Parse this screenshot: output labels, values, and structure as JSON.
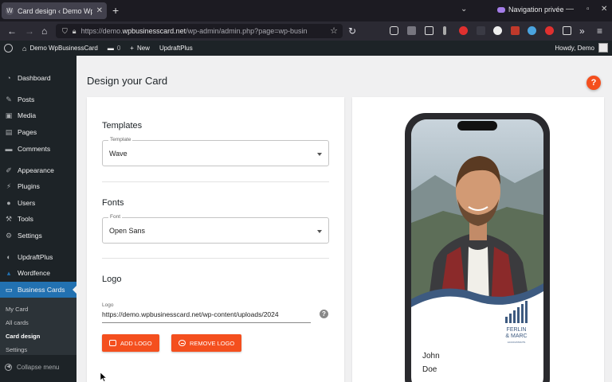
{
  "browser": {
    "tab_title": "Card design ‹ Demo WpB",
    "tab_close": "✕",
    "new_tab": "+",
    "private_label": "Navigation privée",
    "url_prefix": "https://demo.",
    "url_domain": "wpbusinesscard.net",
    "url_rest": "/wp-admin/admin.php?page=wp-busin"
  },
  "adminbar": {
    "site_name": "Demo WpBusinessCard",
    "comments_count": "0",
    "new_label": "New",
    "plugin_label": "UpdraftPlus",
    "howdy": "Howdy, Demo"
  },
  "sidebar": {
    "items": [
      {
        "label": "Dashboard",
        "icon": "dashboard-icon"
      },
      {
        "label": "Posts",
        "icon": "pin-icon"
      },
      {
        "label": "Media",
        "icon": "media-icon"
      },
      {
        "label": "Pages",
        "icon": "pages-icon"
      },
      {
        "label": "Comments",
        "icon": "comment-icon"
      },
      {
        "label": "Appearance",
        "icon": "brush-icon"
      },
      {
        "label": "Plugins",
        "icon": "plugin-icon"
      },
      {
        "label": "Users",
        "icon": "users-icon"
      },
      {
        "label": "Tools",
        "icon": "wrench-icon"
      },
      {
        "label": "Settings",
        "icon": "settings-icon"
      },
      {
        "label": "UpdraftPlus",
        "icon": "updraft-icon"
      },
      {
        "label": "Wordfence",
        "icon": "wordfence-icon"
      },
      {
        "label": "Business Cards",
        "icon": "card-icon"
      }
    ],
    "submenu": [
      "My Card",
      "All cards",
      "Card design",
      "Settings"
    ],
    "collapse_label": "Collapse menu"
  },
  "page": {
    "title": "Design your Card",
    "help": "?"
  },
  "templates": {
    "heading": "Templates",
    "label": "Template",
    "value": "Wave"
  },
  "fonts": {
    "heading": "Fonts",
    "label": "Font",
    "value": "Open Sans"
  },
  "logo": {
    "heading": "Logo",
    "label": "Logo",
    "value": "https://demo.wpbusinesscard.net/wp-content/uploads/2024",
    "info": "?",
    "add_button": "ADD LOGO",
    "remove_button": "REMOVE LOGO"
  },
  "preview": {
    "first_name": "John",
    "last_name": "Doe",
    "company_line1": "FERLIN",
    "company_line2": "& MARC",
    "company_tagline": "ACCOUNTANTS"
  },
  "colors": {
    "accent": "#f44f1e",
    "wp_admin_dark": "#1d2327",
    "wp_blue": "#2271b1",
    "card_wave": "#3d5a80"
  }
}
